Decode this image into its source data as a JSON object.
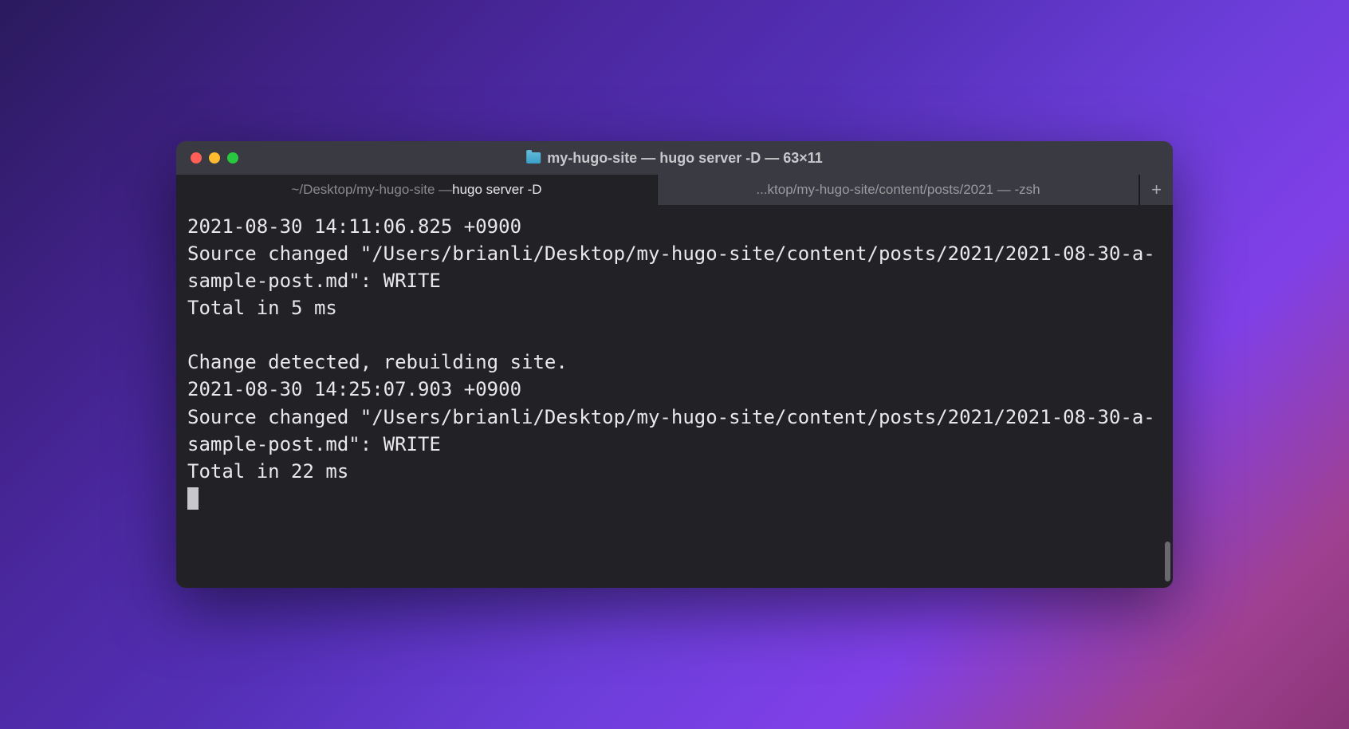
{
  "window": {
    "title": "my-hugo-site — hugo server -D — 63×11"
  },
  "tabs": [
    {
      "label_dim": "~/Desktop/my-hugo-site — ",
      "label_bright": "hugo server -D",
      "active": true
    },
    {
      "label": "...ktop/my-hugo-site/content/posts/2021 — -zsh",
      "active": false
    }
  ],
  "terminal": {
    "lines": [
      "2021-08-30 14:11:06.825 +0900",
      "Source changed \"/Users/brianli/Desktop/my-hugo-site/content/posts/2021/2021-08-30-a-sample-post.md\": WRITE",
      "Total in 5 ms",
      "",
      "Change detected, rebuilding site.",
      "2021-08-30 14:25:07.903 +0900",
      "Source changed \"/Users/brianli/Desktop/my-hugo-site/content/posts/2021/2021-08-30-a-sample-post.md\": WRITE",
      "Total in 22 ms"
    ]
  }
}
